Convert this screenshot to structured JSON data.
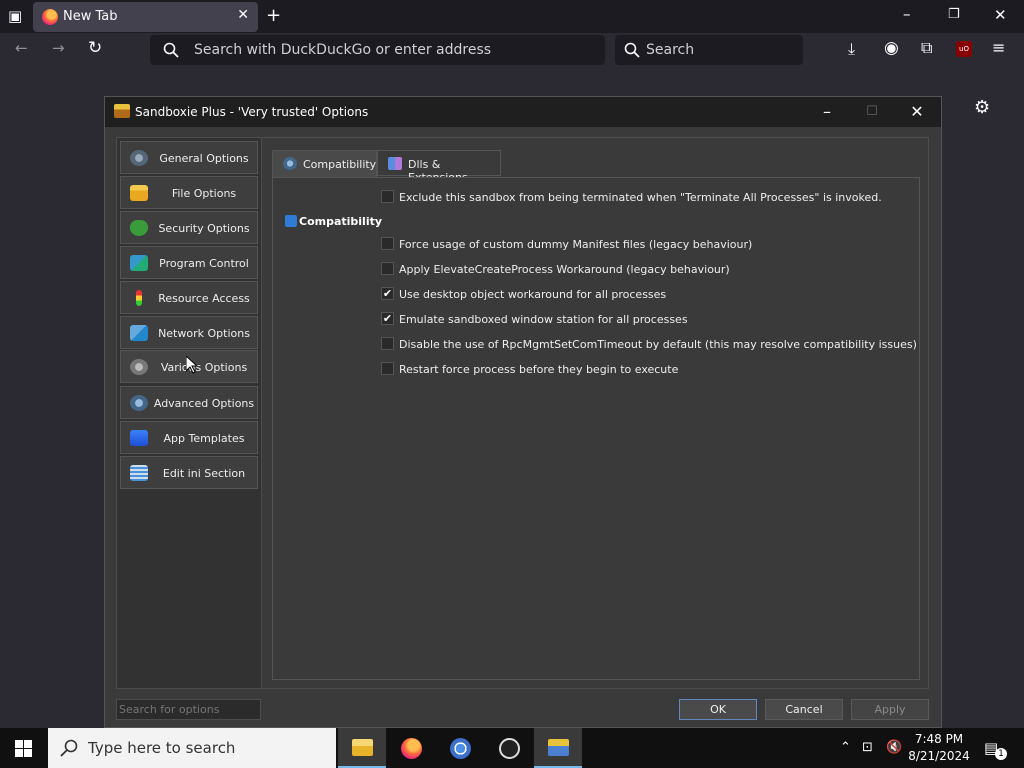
{
  "browser": {
    "tab_title": "New Tab",
    "url_placeholder": "Search with DuckDuckGo or enter address",
    "search_placeholder": "Search"
  },
  "dialog": {
    "title": "Sandboxie Plus - 'Very trusted' Options",
    "nav": [
      {
        "label": "General Options"
      },
      {
        "label": "File Options"
      },
      {
        "label": "Security Options"
      },
      {
        "label": "Program Control"
      },
      {
        "label": "Resource Access"
      },
      {
        "label": "Network Options"
      },
      {
        "label": "Various Options"
      },
      {
        "label": "Advanced Options"
      },
      {
        "label": "App Templates"
      },
      {
        "label": "Edit ini Section"
      }
    ],
    "tabs": [
      {
        "label": "Compatibility",
        "active": true
      },
      {
        "label": "Dlls & Extensions",
        "active": false
      }
    ],
    "section_label": "Compatibility",
    "options": [
      {
        "label": "Exclude this sandbox from being terminated when \"Terminate All Processes\" is invoked.",
        "checked": false
      },
      {
        "label": "Force usage of custom dummy Manifest files (legacy behaviour)",
        "checked": false
      },
      {
        "label": "Apply ElevateCreateProcess Workaround (legacy behaviour)",
        "checked": false
      },
      {
        "label": "Use desktop object workaround for all processes",
        "checked": true
      },
      {
        "label": "Emulate sandboxed window station for all processes",
        "checked": true
      },
      {
        "label": "Disable the use of RpcMgmtSetComTimeout by default (this may resolve compatibility issues)",
        "checked": false
      },
      {
        "label": "Restart force process before they begin to execute",
        "checked": false
      }
    ],
    "search_placeholder": "Search for options",
    "buttons": {
      "ok": "OK",
      "cancel": "Cancel",
      "apply": "Apply"
    }
  },
  "taskbar": {
    "search_placeholder": "Type here to search",
    "time": "7:48 PM",
    "date": "8/21/2024",
    "notification_count": "1"
  }
}
